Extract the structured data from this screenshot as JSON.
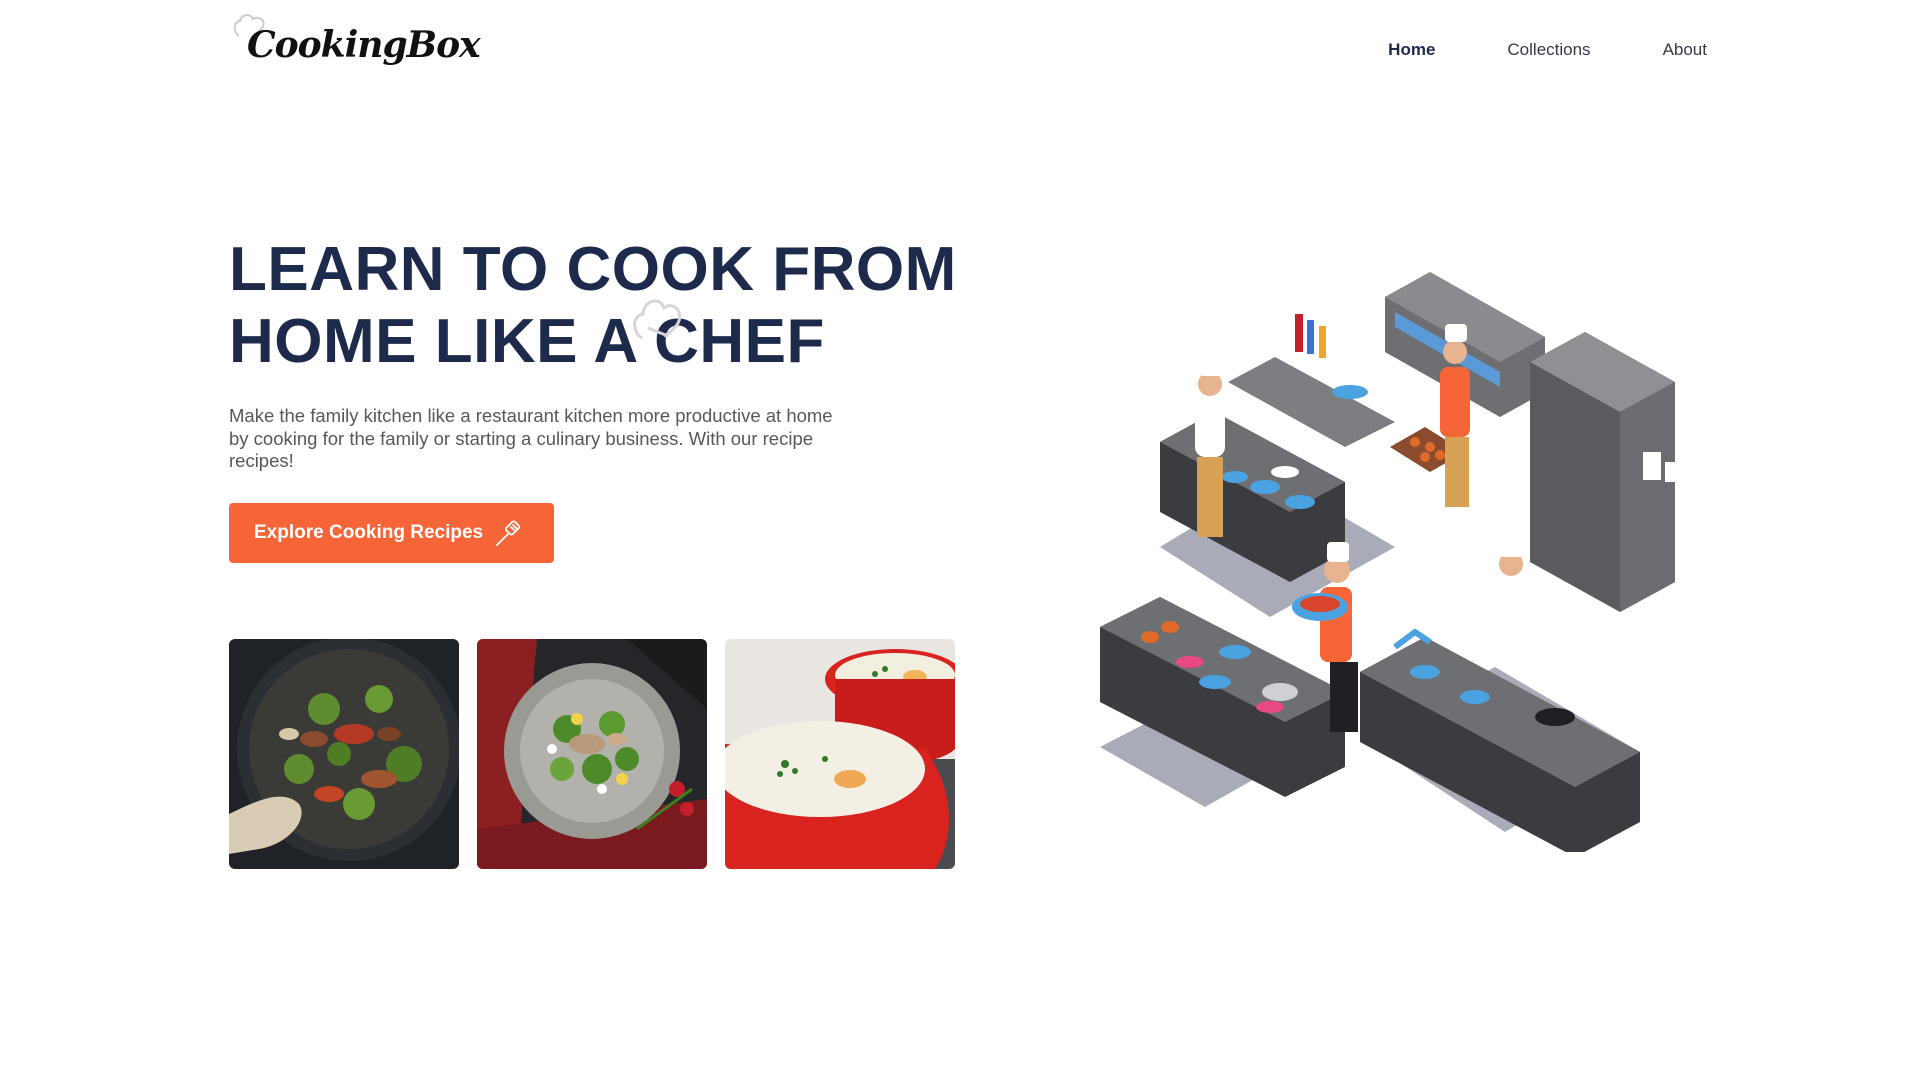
{
  "brand": {
    "name": "CookingBox"
  },
  "nav": {
    "items": [
      {
        "label": "Home",
        "active": true
      },
      {
        "label": "Collections",
        "active": false
      },
      {
        "label": "About",
        "active": false
      }
    ]
  },
  "hero": {
    "title": "LEARN TO COOK FROM HOME LIKE A CHEF",
    "description": "Make the family kitchen like a restaurant kitchen more productive at home by cooking for the family or starting a culinary business. With our recipe recipes!",
    "cta_label": "Explore Cooking Recipes",
    "cta_icon": "spatula-icon"
  },
  "gallery": {
    "photos": [
      {
        "name": "stir-fry-pan-photo"
      },
      {
        "name": "tuna-salad-plate-photo"
      },
      {
        "name": "soup-red-bowls-photo"
      }
    ]
  },
  "colors": {
    "accent": "#f56538",
    "heading": "#1d2a4b",
    "body_text": "#55585f"
  }
}
